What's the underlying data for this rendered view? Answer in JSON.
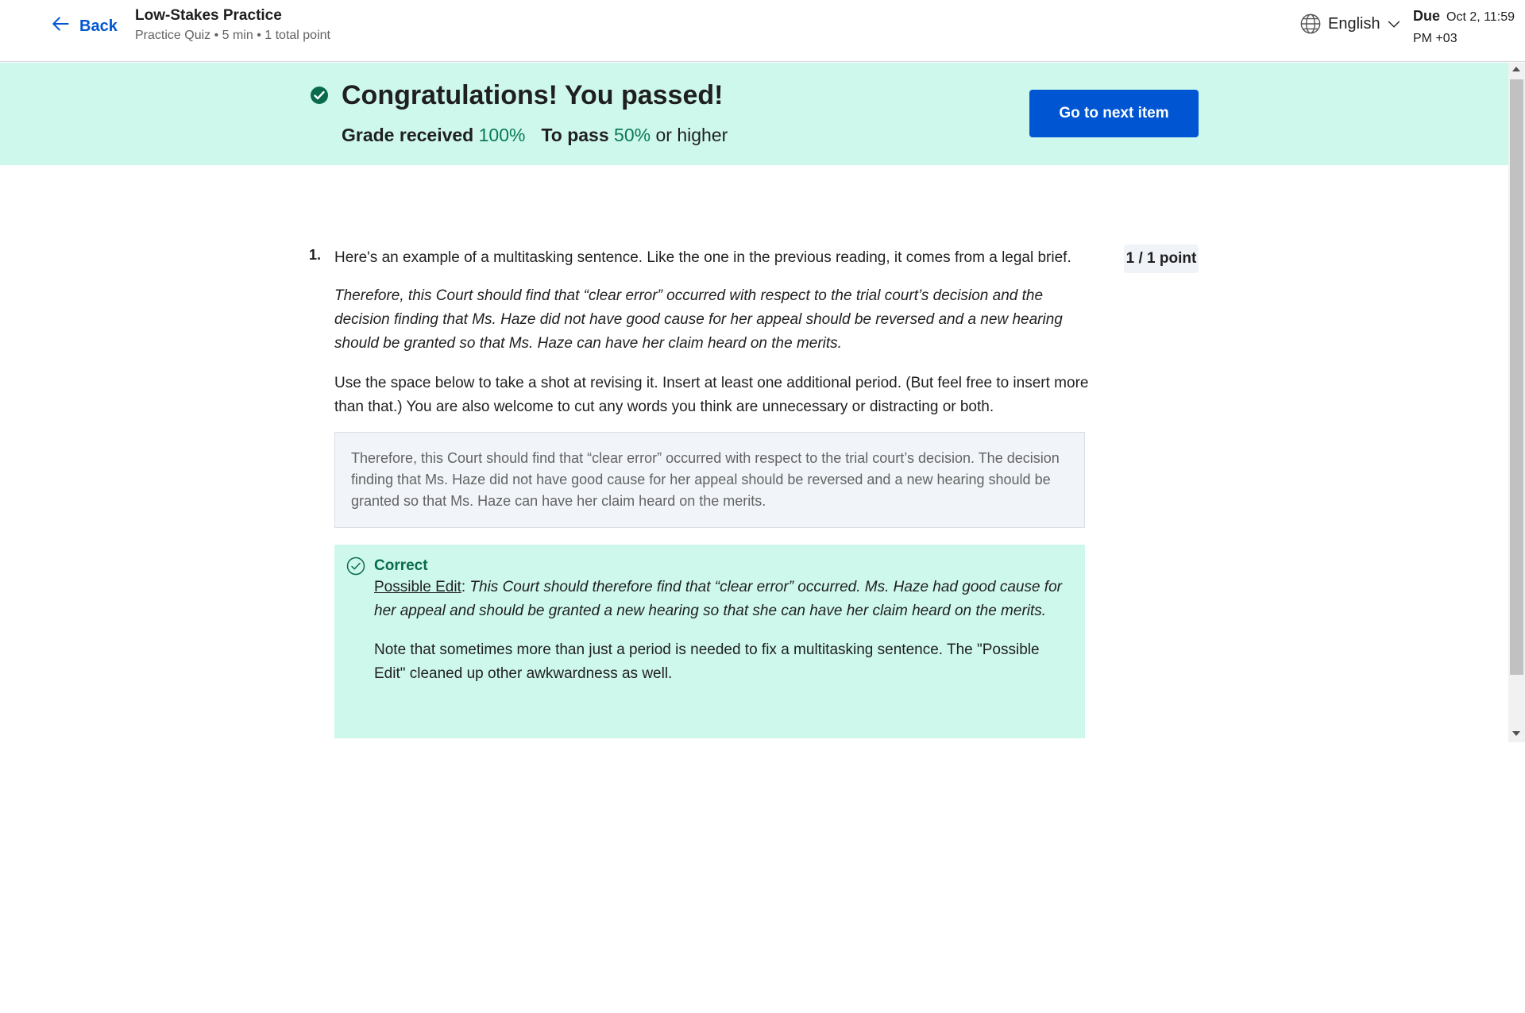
{
  "header": {
    "back_label": "Back",
    "title": "Low-Stakes Practice",
    "subtitle": "Practice Quiz • 5 min • 1 total point",
    "language": "English",
    "due_label": "Due",
    "due_date_line1": "Oct 2, 11:59",
    "due_date_line2": "PM +03"
  },
  "banner": {
    "title": "Congratulations! You passed!",
    "grade_label": "Grade received",
    "grade_value": "100%",
    "pass_label": "To pass",
    "pass_value": "50%",
    "pass_suffix": "or higher",
    "next_button": "Go to next item"
  },
  "question": {
    "number": "1.",
    "prompt": "Here's an example of a multitasking sentence. Like the one in the previous reading, it comes from a legal brief.",
    "example": "Therefore, this Court should find that “clear error” occurred with respect to the trial court’s decision and the decision finding that Ms. Haze did not have good cause for her appeal should be reversed and a new hearing should be granted so that Ms. Haze can have her claim heard on the merits.",
    "instructions": "Use the space below to take a shot at revising it. Insert at least one additional period. (But feel free to insert more than that.) You are also welcome to cut any words you think are unnecessary or distracting or both.",
    "points": "1 / 1 point",
    "answer": "Therefore, this Court should find that “clear error” occurred with respect to the trial court’s decision. The decision finding that Ms. Haze did not have good cause for her appeal should be reversed and a new hearing should be granted so that Ms. Haze can have her claim heard on the merits."
  },
  "feedback": {
    "status": "Correct",
    "edit_label": "Possible Edit",
    "edit_text": "This Court should therefore find that “clear error” occurred. Ms. Haze had good cause for her appeal and should be granted a new hearing so that she can have her claim heard on the merits.",
    "note": "Note that sometimes more than just a period is needed to fix a multitasking sentence. The \"Possible Edit\" cleaned up other awkwardness as well."
  },
  "colors": {
    "accent": "#0056d2",
    "success_bg": "#cef8ec",
    "success_text": "#0a7a56"
  },
  "icons": {
    "back": "arrow-left-icon",
    "language": "globe-icon",
    "language_menu": "chevron-down-icon",
    "passed": "check-circle-filled-icon",
    "correct": "check-circle-outline-icon"
  }
}
